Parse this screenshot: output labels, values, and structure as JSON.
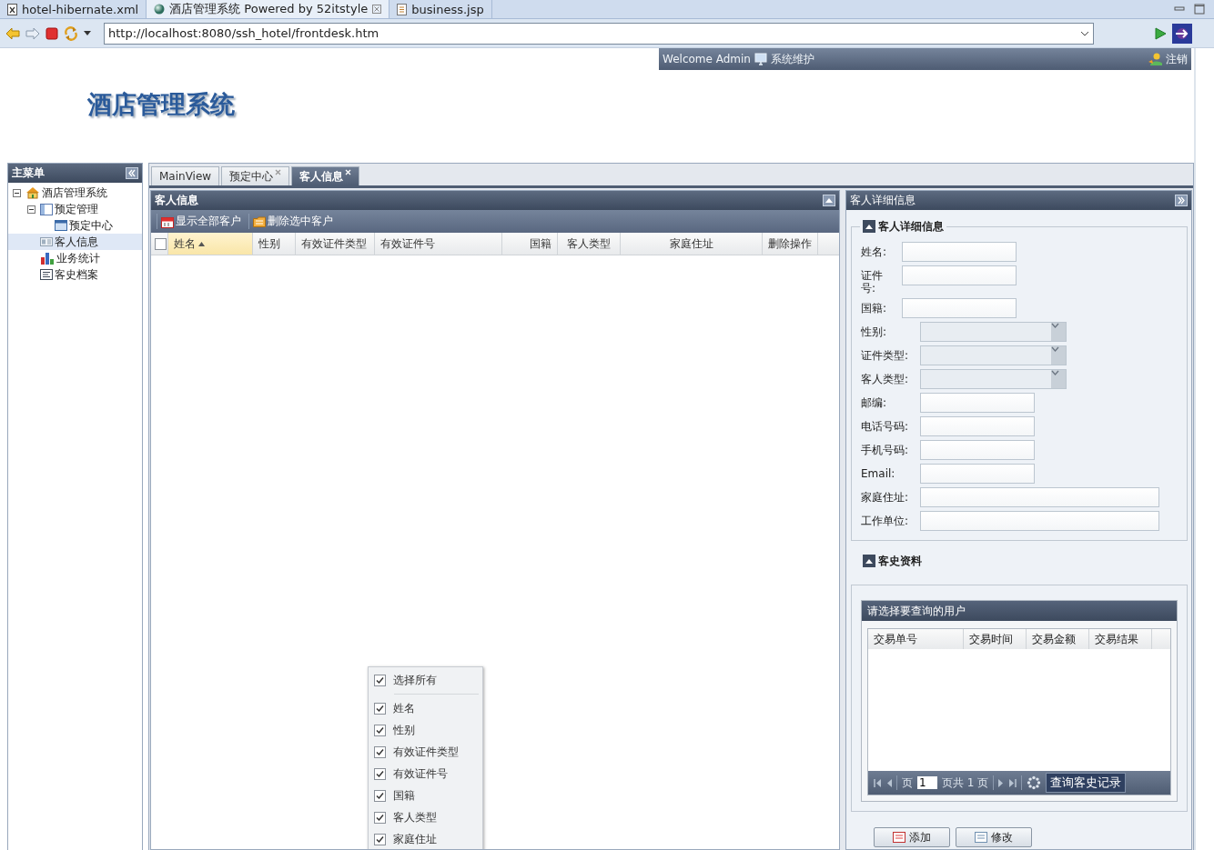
{
  "browser": {
    "tabs": [
      {
        "label": "hotel-hibernate.xml",
        "kind": "xml",
        "selected": false
      },
      {
        "label": "酒店管理系统 Powered by 52itstyle",
        "kind": "web",
        "selected": true
      },
      {
        "label": "business.jsp",
        "kind": "jsp",
        "selected": false
      }
    ],
    "address": "http://localhost:8080/ssh_hotel/frontdesk.htm"
  },
  "header": {
    "welcome": "Welcome Admin",
    "maintenance": "系统维护",
    "logout": "注销",
    "logo": "酒店管理系统"
  },
  "sidebar": {
    "title": "主菜单",
    "tree": [
      {
        "label": "酒店管理系统",
        "expanded": true,
        "selected": false,
        "children": [
          {
            "label": "预定管理",
            "expanded": true,
            "selected": false,
            "children": [
              {
                "label": "预定中心",
                "selected": false
              }
            ]
          },
          {
            "label": "客人信息",
            "selected": true
          },
          {
            "label": "业务统计",
            "selected": false
          },
          {
            "label": "客史档案",
            "selected": false
          }
        ]
      }
    ]
  },
  "tabs": [
    {
      "label": "MainView",
      "closable": false,
      "selected": false
    },
    {
      "label": "预定中心",
      "closable": true,
      "selected": false
    },
    {
      "label": "客人信息",
      "closable": true,
      "selected": true
    }
  ],
  "grid": {
    "title": "客人信息",
    "toolbar": [
      "显示全部客户",
      "删除选中客户"
    ],
    "select_all_checked": false,
    "columns": [
      {
        "label": "姓名",
        "sorted": true
      },
      {
        "label": "性别",
        "sorted": false
      },
      {
        "label": "有效证件类型",
        "sorted": false
      },
      {
        "label": "有效证件号",
        "sorted": false
      },
      {
        "label": "国籍",
        "sorted": false
      },
      {
        "label": "客人类型",
        "sorted": false
      },
      {
        "label": "家庭住址",
        "sorted": false
      },
      {
        "label": "删除操作",
        "sorted": false
      }
    ],
    "column_menu": [
      {
        "label": "选择所有",
        "checked": true
      },
      {
        "label": "姓名",
        "checked": true
      },
      {
        "label": "性别",
        "checked": true
      },
      {
        "label": "有效证件类型",
        "checked": true
      },
      {
        "label": "有效证件号",
        "checked": true
      },
      {
        "label": "国籍",
        "checked": true
      },
      {
        "label": "客人类型",
        "checked": true
      },
      {
        "label": "家庭住址",
        "checked": true
      }
    ]
  },
  "detail": {
    "title": "客人详细信息",
    "fieldset": "客人详细信息",
    "fields": [
      {
        "label": "姓名:",
        "kind": "text"
      },
      {
        "label": "证件号:",
        "kind": "text"
      },
      {
        "label": "国籍:",
        "kind": "text"
      },
      {
        "label": "性别:",
        "kind": "combo"
      },
      {
        "label": "证件类型:",
        "kind": "combo"
      },
      {
        "label": "客人类型:",
        "kind": "combo"
      },
      {
        "label": "邮编:",
        "kind": "text"
      },
      {
        "label": "电话号码:",
        "kind": "text"
      },
      {
        "label": "手机号码:",
        "kind": "text"
      },
      {
        "label": "Email:",
        "kind": "text"
      },
      {
        "label": "家庭住址:",
        "kind": "long"
      },
      {
        "label": "工作单位:",
        "kind": "long"
      }
    ],
    "history": {
      "legend": "客史资料",
      "title": "请选择要查询的用户",
      "columns": [
        "交易单号",
        "交易时间",
        "交易金额",
        "交易结果"
      ],
      "pager": {
        "page_label": "页",
        "page": "1",
        "total": "页共 1 页",
        "query": "查询客史记录"
      }
    },
    "buttons": [
      "添加",
      "修改"
    ]
  }
}
